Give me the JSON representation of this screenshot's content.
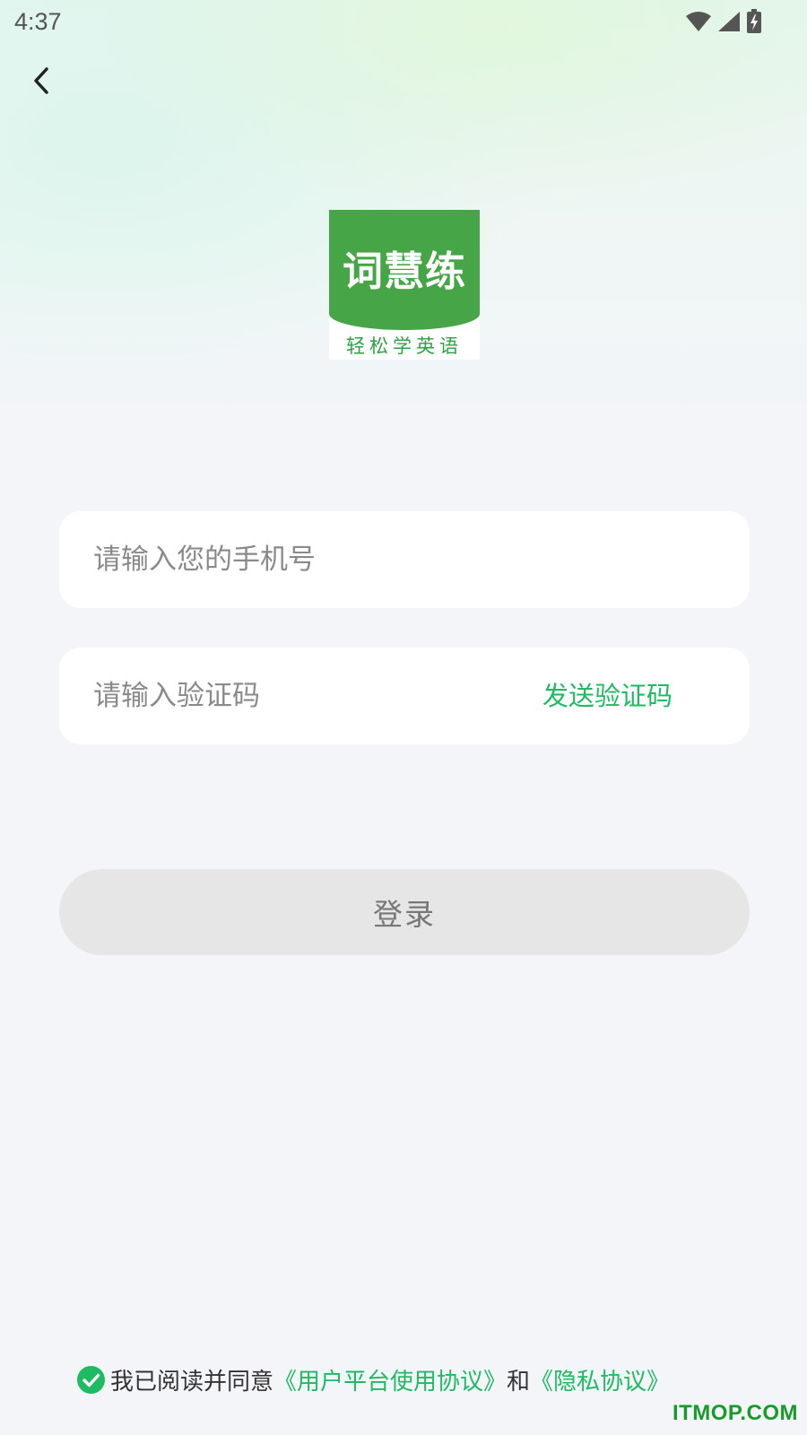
{
  "status_bar": {
    "time": "4:37"
  },
  "app": {
    "logo_title": "词慧练",
    "logo_subtitle": "轻松学英语",
    "brand_color": "#45a547",
    "accent_color": "#1ebb62"
  },
  "form": {
    "phone_placeholder": "请输入您的手机号",
    "code_placeholder": "请输入验证码",
    "send_code_label": "发送验证码",
    "login_label": "登录"
  },
  "agreement": {
    "checked": true,
    "prefix": "我已阅读并同意",
    "user_agreement": "《用户平台使用协议》",
    "conjunction": "和",
    "privacy_policy": "《隐私协议》"
  },
  "watermark": "ITMOP.COM"
}
